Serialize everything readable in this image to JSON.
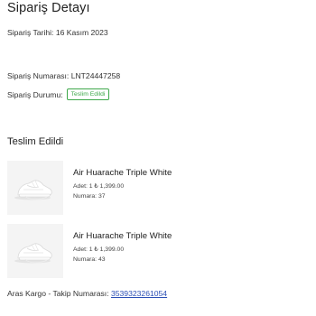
{
  "page": {
    "title": "Sipariş Detayı"
  },
  "order": {
    "date_label": "Sipariş Tarihi:",
    "date_value": "16 Kasım 2023",
    "number_label": "Sipariş Numarası:",
    "number_value": "LNT24447258",
    "status_label": "Sipariş Durumu:",
    "status_badge": "Teslim Edildi",
    "status_color": "#3ea84a"
  },
  "delivery": {
    "heading": "Teslim Edildi"
  },
  "products": [
    {
      "name": "Air Huarache Triple White",
      "quantity_price": "Adet: 1 ₺ 1,399.00",
      "size": "Numara: 37",
      "image_icon": "white-sneaker-image"
    },
    {
      "name": "Air Huarache Triple White",
      "quantity_price": "Adet: 1 ₺ 1,399.00",
      "size": "Numara: 43",
      "image_icon": "white-sneaker-image"
    }
  ],
  "shipping": {
    "label": "Aras Kargo - Takip Numarası:",
    "tracking_number": "3539323261054",
    "link_color": "#2b4fb5"
  }
}
